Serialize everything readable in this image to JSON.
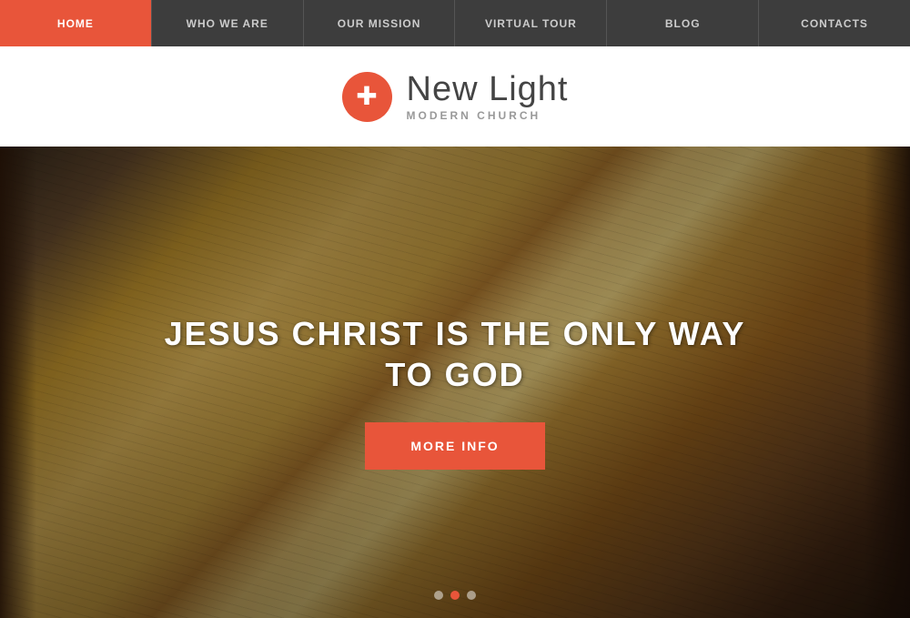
{
  "nav": {
    "items": [
      {
        "id": "home",
        "label": "HOME",
        "active": true
      },
      {
        "id": "who-we-are",
        "label": "WHO WE ARE",
        "active": false
      },
      {
        "id": "our-mission",
        "label": "OUR MISSION",
        "active": false
      },
      {
        "id": "virtual-tour",
        "label": "VIRTUAL TOUR",
        "active": false
      },
      {
        "id": "blog",
        "label": "BLOG",
        "active": false
      },
      {
        "id": "contacts",
        "label": "CONTACTS",
        "active": false
      }
    ]
  },
  "logo": {
    "icon": "+",
    "title": "New Light",
    "subtitle": "MODERN CHURCH"
  },
  "hero": {
    "title": "JESUS CHRIST IS THE ONLY WAY TO GOD",
    "cta_label": "MORE INFO"
  },
  "slider": {
    "dots": [
      {
        "id": 1,
        "active": false
      },
      {
        "id": 2,
        "active": true
      },
      {
        "id": 3,
        "active": false
      }
    ]
  },
  "colors": {
    "accent": "#e8553a",
    "nav_bg": "#3d3d3d",
    "white": "#ffffff"
  }
}
